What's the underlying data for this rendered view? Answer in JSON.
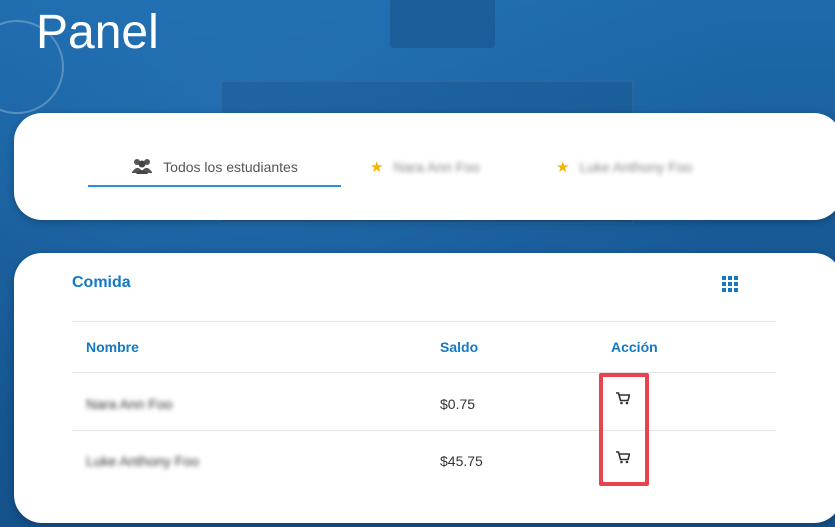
{
  "page": {
    "title": "Panel"
  },
  "tabs": [
    {
      "label": "Todos los estudiantes",
      "icon": "users-icon",
      "active": true
    },
    {
      "label": "Nara Ann Foo",
      "icon": "star-icon",
      "active": false
    },
    {
      "label": "Luke Anthony Foo",
      "icon": "star-icon",
      "active": false
    }
  ],
  "section": {
    "title": "Comida",
    "menu_icon": "grid-icon"
  },
  "table": {
    "columns": [
      "Nombre",
      "Saldo",
      "Acción"
    ],
    "rows": [
      {
        "name": "Nara Ann Foo",
        "balance": "$0.75",
        "action_icon": "cart-icon"
      },
      {
        "name": "Luke Anthony Foo",
        "balance": "$45.75",
        "action_icon": "cart-icon"
      }
    ]
  },
  "colors": {
    "accent": "#1479c4",
    "tab_underline": "#2a8fd8",
    "highlight": "#e8444d",
    "star": "#f4b400"
  }
}
